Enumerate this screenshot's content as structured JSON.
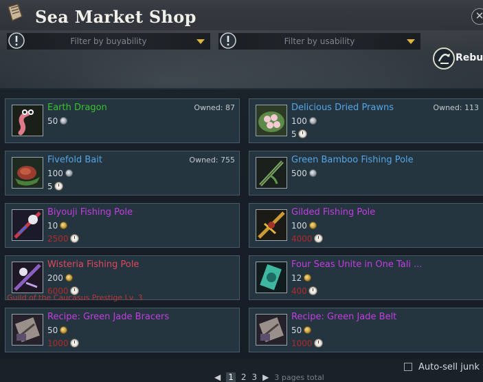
{
  "window": {
    "title": "Sea Market Shop",
    "close_glyph": "✕"
  },
  "filters": [
    {
      "label": "Filter by buyability",
      "icon": "warning-icon"
    },
    {
      "label": "Filter by usability",
      "icon": "warning-icon"
    }
  ],
  "rebuy": {
    "label": "Rebuy"
  },
  "items": [
    {
      "name": "Earth Dragon",
      "owned": "Owned: 87",
      "price": "50",
      "currency": "silver",
      "extra_price": "",
      "color": "green"
    },
    {
      "name": "Delicious Dried Prawns",
      "owned": "Owned: 113",
      "price": "100",
      "currency": "silver",
      "extra_price": "5",
      "extra_red": false,
      "color": "blue"
    },
    {
      "name": "Fivefold Bait",
      "owned": "Owned: 755",
      "price": "100",
      "currency": "silver",
      "extra_price": "5",
      "extra_red": false,
      "color": "blue"
    },
    {
      "name": "Green Bamboo Fishing Pole",
      "owned": "",
      "price": "500",
      "currency": "silver",
      "extra_price": "",
      "color": "blue"
    },
    {
      "name": "Biyouji Fishing Pole",
      "owned": "",
      "price": "10",
      "currency": "gold",
      "extra_price": "2500",
      "extra_red": true,
      "color": "purple"
    },
    {
      "name": "Gilded Fishing Pole",
      "owned": "",
      "price": "100",
      "currency": "gold",
      "extra_price": "4000",
      "extra_red": true,
      "color": "purple"
    },
    {
      "name": "Wisteria Fishing Pole",
      "owned": "",
      "price": "200",
      "currency": "gold",
      "extra_price": "6000",
      "extra_red": true,
      "color": "red"
    },
    {
      "name": "Four Seas Unite in One Tali ...",
      "owned": "",
      "price": "12",
      "currency": "gold",
      "extra_price": "400",
      "extra_red": true,
      "color": "purple"
    },
    {
      "name": "Recipe: Green Jade Bracers",
      "owned": "",
      "price": "50",
      "currency": "gold",
      "extra_price": "1000",
      "extra_red": true,
      "color": "purple"
    },
    {
      "name": "Recipe: Green Jade Belt",
      "owned": "",
      "price": "50",
      "currency": "gold",
      "extra_price": "1000",
      "extra_red": true,
      "color": "purple"
    }
  ],
  "condition_text": "Guild of the Caucasus Prestige Lv. 3",
  "autosell": {
    "label": "Auto-sell junk"
  },
  "pager": {
    "prev": "◀",
    "pages": [
      "1",
      "2",
      "3"
    ],
    "next": "▶",
    "total": "3 pages total"
  },
  "colors": {
    "green": "#38c22e",
    "blue": "#55a6e6",
    "purple": "#c23ee0",
    "red": "#e0485c",
    "accent": "#e2b53b"
  }
}
